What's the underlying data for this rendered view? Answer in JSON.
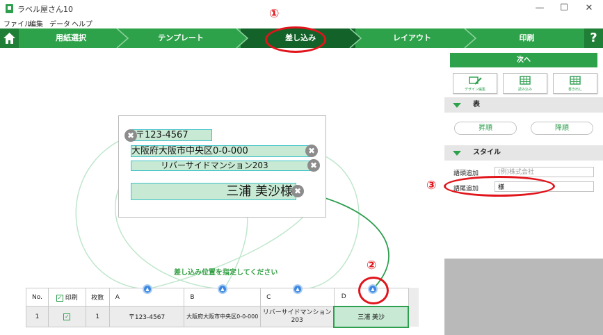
{
  "window": {
    "title": "ラベル屋さん10",
    "controls": [
      "—",
      "☐",
      "✕"
    ]
  },
  "menu": [
    "ファイル",
    "編集",
    "データ",
    "ヘルプ"
  ],
  "nav": {
    "steps": [
      "用紙選択",
      "テンプレート",
      "差し込み",
      "レイアウト",
      "印刷"
    ],
    "active_step": "差し込み",
    "help": "?"
  },
  "label_fields": [
    {
      "text": "〒123-4567"
    },
    {
      "text": "大阪府大阪市中央区0-0-000"
    },
    {
      "text": "リバーサイドマンション203"
    },
    {
      "text": "三浦 美沙様"
    }
  ],
  "delete_glyph": "✖",
  "hint": "差し込み位置を指定してください",
  "table": {
    "headers": {
      "no": "No.",
      "print": "印刷",
      "count": "枚数",
      "a": "A",
      "b": "B",
      "c": "C",
      "d": "D"
    },
    "row": {
      "no": "1",
      "count": "1",
      "a": "〒123-4567",
      "b": "大阪府大阪市中央区0-0-000",
      "c": "リバーサイドマンション 203",
      "d": "三浦 美沙"
    }
  },
  "panel": {
    "next": "次へ",
    "tools": [
      "デザイン編集",
      "読み込み",
      "書き出し"
    ],
    "section_table": "表",
    "sort_asc": "昇順",
    "sort_desc": "降順",
    "section_style": "スタイル",
    "prefix_label": "語頭追加",
    "prefix_placeholder": "(例)株式会社",
    "suffix_label": "語尾追加",
    "suffix_value": "様"
  },
  "annotations": [
    "①",
    "②",
    "③"
  ],
  "colors": {
    "accent": "#2ea24a",
    "nav_active": "#13622a",
    "annotation": "#e1141b",
    "marker": "#3b86e0"
  }
}
